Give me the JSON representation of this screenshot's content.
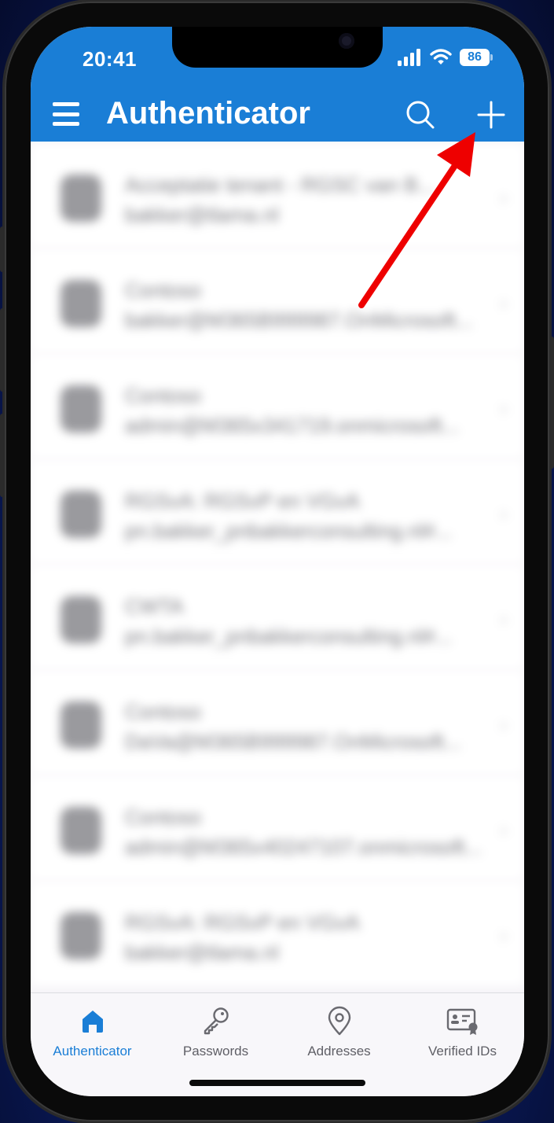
{
  "status_bar": {
    "time": "20:41",
    "battery": "86"
  },
  "header": {
    "title": "Authenticator"
  },
  "accounts": [
    {
      "name": "Acceptatie tenant - RGSC van B...",
      "user": "bakker@tlama.nl"
    },
    {
      "name": "Contoso",
      "user": "bakker@M365B999987.OnMicrosoft..."
    },
    {
      "name": "Contoso",
      "user": "admin@M365x341719.onmicrosoft..."
    },
    {
      "name": "RGSvA: RGSvP en VGvA",
      "user": "pn.bakker_pnbakkerconsulting.nl#..."
    },
    {
      "name": "CWTA",
      "user": "pn.bakker_pnbakkerconsulting.nl#..."
    },
    {
      "name": "Contoso",
      "user": "DaVa@M365B999987.OnMicrosoft..."
    },
    {
      "name": "Contoso",
      "user": "admin@M365x40247107.onmicrosoft..."
    },
    {
      "name": "RGSvA: RGSvP en VGvA",
      "user": "bakker@tlama.nl"
    }
  ],
  "tabs": [
    {
      "label": "Authenticator",
      "icon": "home-icon",
      "active": true
    },
    {
      "label": "Passwords",
      "icon": "key-icon",
      "active": false
    },
    {
      "label": "Addresses",
      "icon": "location-pin-icon",
      "active": false
    },
    {
      "label": "Verified IDs",
      "icon": "id-card-icon",
      "active": false
    }
  ],
  "colors": {
    "brand": "#1a7ed6",
    "annotation_arrow": "#ee0000"
  }
}
